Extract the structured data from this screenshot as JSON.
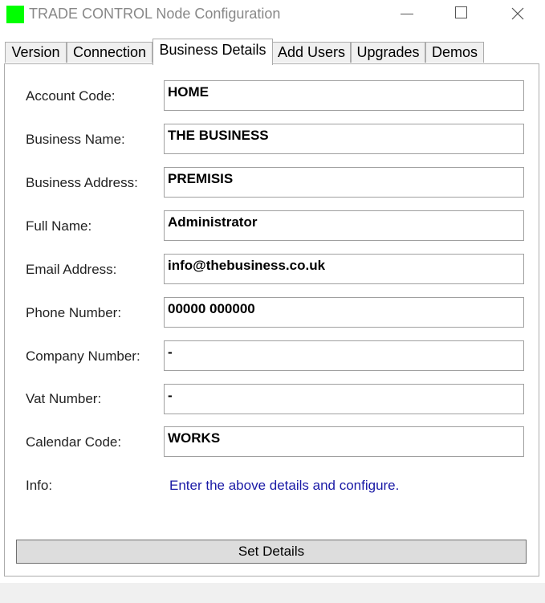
{
  "window": {
    "title": "TRADE CONTROL Node Configuration",
    "icon_color": "#00ff00"
  },
  "tabs": [
    {
      "label": "Version"
    },
    {
      "label": "Connection"
    },
    {
      "label": "Business Details",
      "active": true
    },
    {
      "label": "Add Users"
    },
    {
      "label": "Upgrades"
    },
    {
      "label": "Demos"
    }
  ],
  "form": {
    "account_code": {
      "label": "Account Code:",
      "value": "HOME"
    },
    "business_name": {
      "label": "Business Name:",
      "value": "THE BUSINESS"
    },
    "business_address": {
      "label": "Business Address:",
      "value": "PREMISIS"
    },
    "full_name": {
      "label": "Full Name:",
      "value": "Administrator"
    },
    "email_address": {
      "label": "Email Address:",
      "value": "info@thebusiness.co.uk"
    },
    "phone_number": {
      "label": "Phone Number:",
      "value": "00000 000000"
    },
    "company_number": {
      "label": "Company Number:",
      "value": "-"
    },
    "vat_number": {
      "label": "Vat Number:",
      "value": "-"
    },
    "calendar_code": {
      "label": "Calendar Code:",
      "value": "WORKS"
    },
    "info": {
      "label": "Info:",
      "value": "Enter the above details and configure."
    }
  },
  "buttons": {
    "set_details": "Set Details"
  },
  "colors": {
    "info_text": "#1a1aa6",
    "active_tab": "#ffffff",
    "inactive_tab": "#f0f0f0"
  }
}
